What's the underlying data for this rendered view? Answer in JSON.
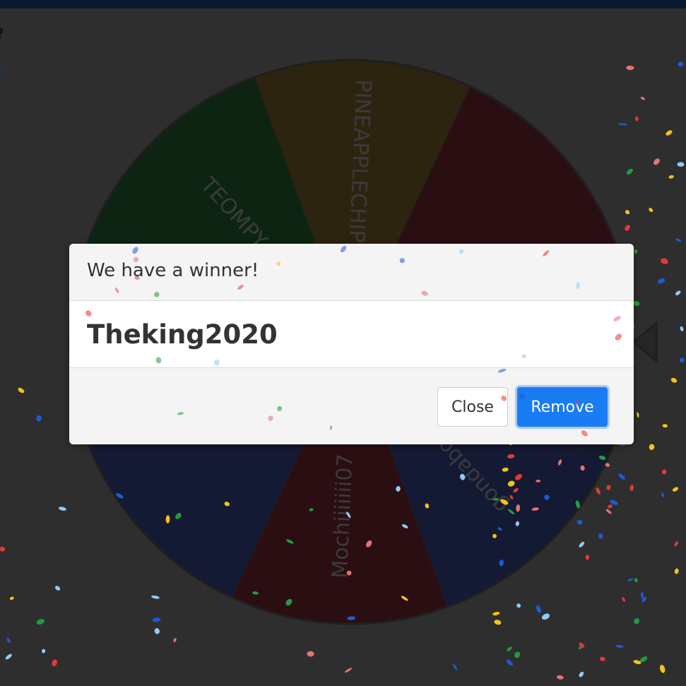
{
  "page": {
    "edge_glyphs": [
      "?",
      "<"
    ]
  },
  "wheel": {
    "segments": [
      {
        "label": "TEOMPY",
        "color": "#0d2412"
      },
      {
        "label": "PINEAPPLECHIPS",
        "color": "#2d2410"
      },
      {
        "label": "",
        "color": "#2b0e12"
      },
      {
        "label": "Theking2020",
        "color": "#14182a"
      },
      {
        "label": "gondaboy",
        "color": "#141a33"
      },
      {
        "label": "Mochiiiiiii07",
        "color": "#2b0e12"
      },
      {
        "label": "",
        "color": "#141a33"
      },
      {
        "label": "",
        "color": "#0d2412"
      }
    ],
    "colors": {
      "rim": "#1f1f1f",
      "label": "#3b3b3b"
    }
  },
  "modal": {
    "title": "We have a winner!",
    "winner": "Theking2020",
    "buttons": {
      "close": "Close",
      "remove": "Remove"
    },
    "colors": {
      "primary": "#1a7cf2",
      "header_bg": "#f4f4f4",
      "body_bg": "#ffffff"
    }
  },
  "pointer": {
    "icon": "triangle-pointer-icon",
    "color": "#1f1f1f"
  },
  "confetti": {
    "colors": [
      "#e53935",
      "#1e5ad6",
      "#f2c318",
      "#1f9e3f",
      "#e57373",
      "#90caf9"
    ]
  }
}
